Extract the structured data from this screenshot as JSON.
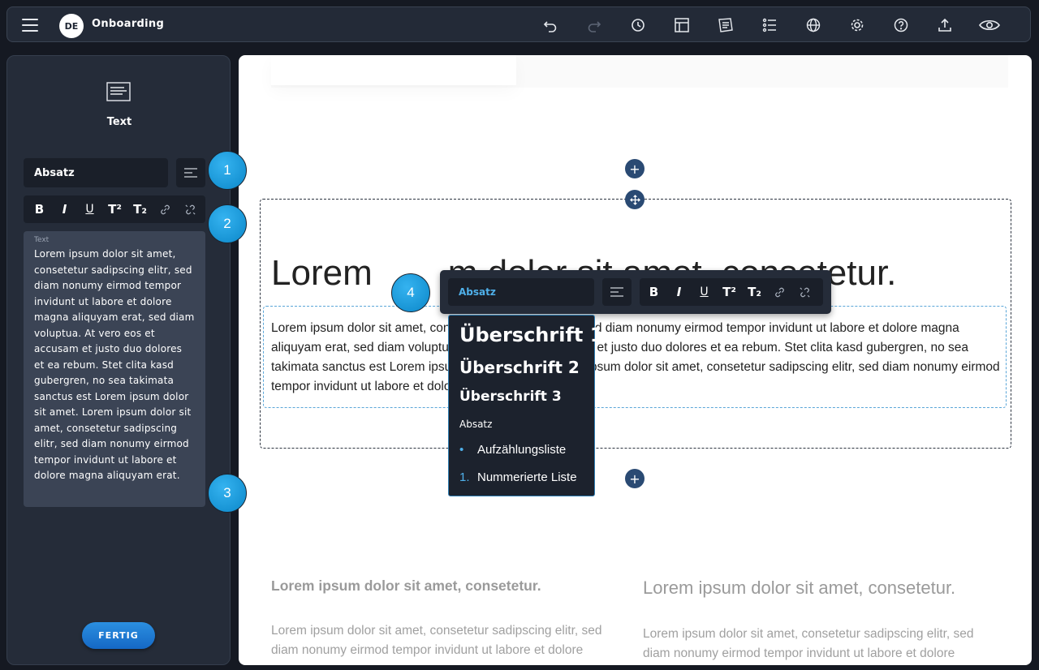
{
  "header": {
    "menu_icon": "hamburger-icon",
    "avatar_initials": "DE",
    "title": "Onboarding",
    "icons": [
      "undo-icon",
      "redo-icon",
      "history-icon",
      "layout-icon",
      "gallery-icon",
      "list-icon",
      "globe-icon",
      "gear-icon",
      "help-icon",
      "upload-icon",
      "eye-icon"
    ]
  },
  "sidebar": {
    "block_icon": "text-block-icon",
    "block_title": "Text",
    "style_select": "Absatz",
    "format_buttons": [
      "B",
      "I",
      "U",
      "T²",
      "T₂"
    ],
    "text_label": "Text",
    "text_value": "Lorem ipsum dolor sit amet, consetetur sadipscing elitr, sed diam nonumy eirmod tempor invidunt ut labore et dolore magna aliquyam erat, sed diam voluptua. At vero eos et accusam et justo duo dolores et ea rebum. Stet clita kasd gubergren, no sea takimata sanctus est Lorem ipsum dolor sit amet. Lorem ipsum dolor sit amet, consetetur sadipscing elitr, sed diam nonumy eirmod tempor invidunt ut labore et dolore magna aliquyam erat.",
    "done_button": "FERTIG"
  },
  "badges": [
    "1",
    "2",
    "3",
    "4"
  ],
  "canvas": {
    "heading_left": "Lorem",
    "heading_right": "m dolor sit amet, consetetur.",
    "paragraph": "Lorem ipsum dolor sit amet, consetetur sadipscing elitr, sed diam nonumy eirmod tempor invidunt ut labore et dolore magna aliquyam erat, sed diam voluptua. At vero eos et accusam et justo duo dolores et ea rebum. Stet clita kasd gubergren, no sea takimata sanctus est Lorem ipsum dolor sit amet. Lorem ipsum dolor sit amet, consetetur sadipscing elitr, sed diam nonumy eirmod tempor invidunt ut labore et dolore magna aliquyam erat.",
    "col1_heading": "Lorem ipsum dolor sit amet, consetetur.",
    "col2_heading": "Lorem ipsum dolor sit amet, consetetur.",
    "col1_paragraph": "Lorem ipsum dolor sit amet, consetetur sadipscing elitr, sed diam nonumy eirmod tempor invidunt ut labore et dolore",
    "col2_paragraph": "Lorem ipsum dolor sit amet, consetetur sadipscing elitr, sed diam nonumy eirmod tempor invidunt ut labore et dolore",
    "add_symbol": "+"
  },
  "floating_toolbar": {
    "style_select": "Absatz"
  },
  "dropdown": {
    "h1": "Überschrift 1",
    "h2": "Überschrift 2",
    "h3": "Überschrift 3",
    "paragraph": "Absatz",
    "bullet_marker": "•",
    "bullet_list": "Aufzählungsliste",
    "numbered_marker": "1.",
    "numbered_list": "Nummerierte Liste"
  },
  "colors": {
    "accent": "#4fb0ea",
    "badge": "#1a9ad8",
    "add_button": "#2a4a73"
  }
}
